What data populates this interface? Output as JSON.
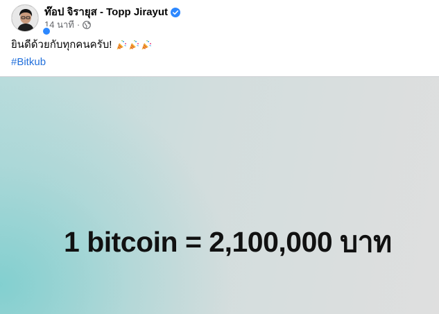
{
  "post": {
    "author_name": "ท๊อป จิรายุส - Topp Jirayut",
    "time_ago": "14 นาที",
    "separator": "·",
    "privacy_icon": "globe-icon",
    "verified_icon": "verified-badge-icon",
    "text": "ยินดีด้วยกับทุกคนครับ!",
    "emojis": [
      "party-popper-icon",
      "party-popper-icon",
      "party-popper-icon"
    ],
    "hashtag": "#Bitkub"
  },
  "image": {
    "headline": "1 bitcoin = 2,100,000 บาท"
  },
  "colors": {
    "link": "#216fdb",
    "secondary_text": "#65676b",
    "verified": "#2d88ff",
    "image_teal": "#8fd2d2",
    "image_grey": "#dfdfdf"
  }
}
